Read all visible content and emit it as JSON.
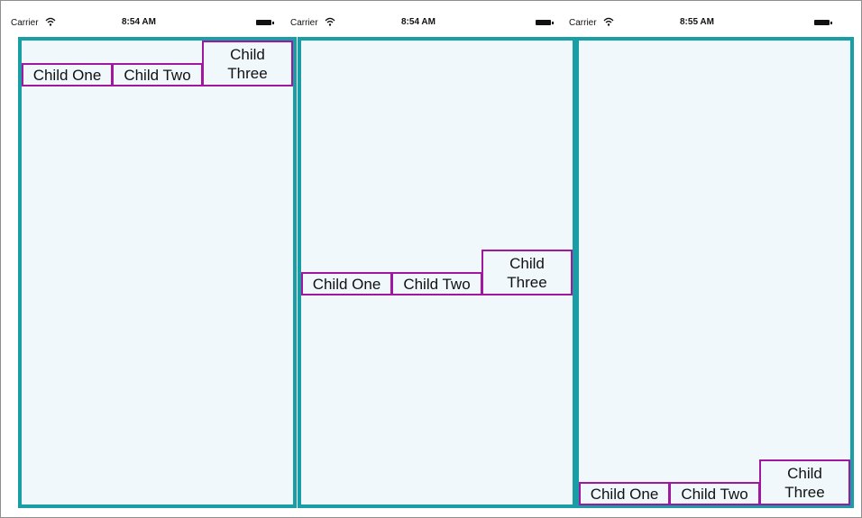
{
  "screens": [
    {
      "status": {
        "carrier": "Carrier",
        "time": "8:54 AM"
      },
      "alignment": "top",
      "children": [
        {
          "label": "Child One"
        },
        {
          "label": "Child Two"
        },
        {
          "label_line1": "Child",
          "label_line2": "Three"
        }
      ]
    },
    {
      "status": {
        "carrier": "Carrier",
        "time": "8:54 AM"
      },
      "alignment": "center",
      "children": [
        {
          "label": "Child One"
        },
        {
          "label": "Child Two"
        },
        {
          "label_line1": "Child",
          "label_line2": "Three"
        }
      ]
    },
    {
      "status": {
        "carrier": "Carrier",
        "time": "8:55 AM"
      },
      "alignment": "bottom",
      "children": [
        {
          "label": "Child One"
        },
        {
          "label": "Child Two"
        },
        {
          "label_line1": "Child",
          "label_line2": "Three"
        }
      ]
    }
  ],
  "colors": {
    "container_border": "#1a9ea6",
    "container_bg": "#f1f8fc",
    "child_border": "#a0189f"
  },
  "icons": {
    "wifi": "wifi-icon",
    "battery": "battery-icon"
  }
}
